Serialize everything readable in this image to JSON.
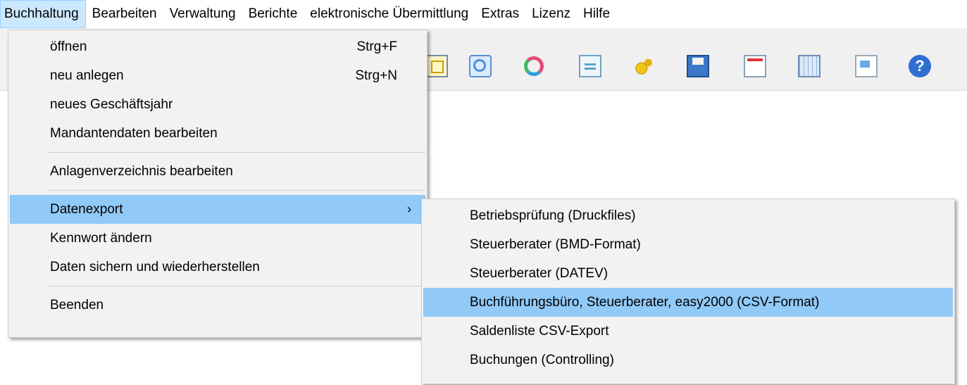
{
  "menubar": {
    "items": [
      "Buchhaltung",
      "Bearbeiten",
      "Verwaltung",
      "Berichte",
      "elektronische Übermittlung",
      "Extras",
      "Lizenz",
      "Hilfe"
    ]
  },
  "toolbar": {
    "icons": [
      "grid-icon",
      "zoom-grid-icon",
      "refresh-icon",
      "document-icon",
      "gears-icon",
      "save-icon",
      "calendar-icon",
      "table-icon",
      "report-icon",
      "help-icon"
    ],
    "help_glyph": "?"
  },
  "main_menu": {
    "open": "öffnen",
    "open_shortcut": "Strg+F",
    "new": "neu anlegen",
    "new_shortcut": "Strg+N",
    "new_fiscal_year": "neues Geschäftsjahr",
    "edit_client": "Mandantendaten bearbeiten",
    "edit_assets": "Anlagenverzeichnis bearbeiten",
    "data_export": "Datenexport",
    "data_export_arrow": "›",
    "change_password": "Kennwort ändern",
    "backup_restore": "Daten sichern und wiederherstellen",
    "exit": "Beenden"
  },
  "export_submenu": {
    "items": [
      "Betriebsprüfung (Druckfiles)",
      "Steuerberater (BMD-Format)",
      "Steuerberater (DATEV)",
      "Buchführungsbüro, Steuerberater, easy2000 (CSV-Format)",
      "Saldenliste CSV-Export",
      "Buchungen (Controlling)"
    ],
    "highlighted_index": 3
  },
  "colors": {
    "menu_highlight": "#91c9f7",
    "menubar_active": "#cce8ff",
    "menu_background": "#f2f2f2"
  }
}
